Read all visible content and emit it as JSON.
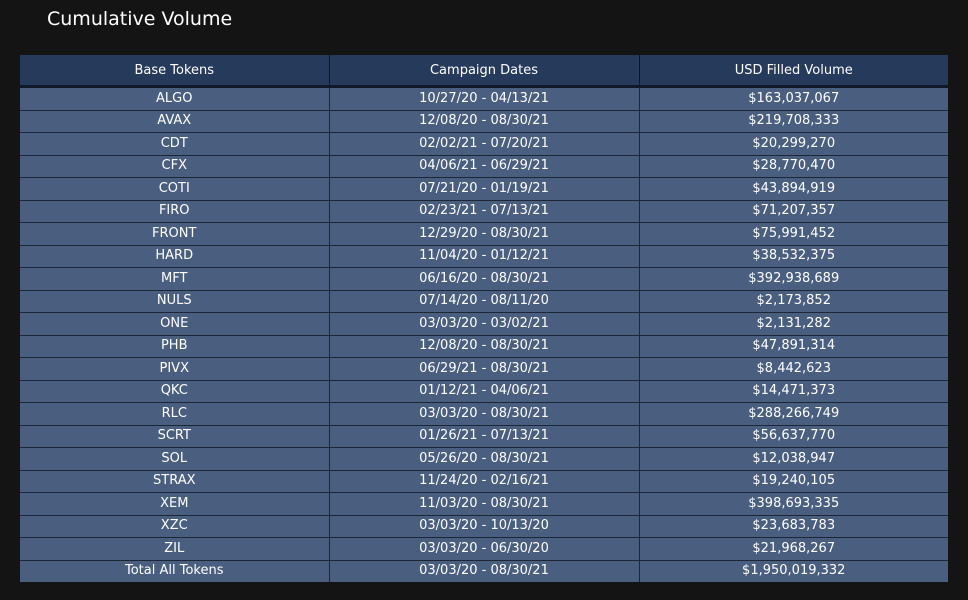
{
  "title": "Cumulative Volume",
  "table": {
    "headers": [
      "Base Tokens",
      "Campaign Dates",
      "USD Filled Volume"
    ],
    "rows": [
      [
        "ALGO",
        "10/27/20 - 04/13/21",
        "$163,037,067"
      ],
      [
        "AVAX",
        "12/08/20 - 08/30/21",
        "$219,708,333"
      ],
      [
        "CDT",
        "02/02/21 - 07/20/21",
        "$20,299,270"
      ],
      [
        "CFX",
        "04/06/21 - 06/29/21",
        "$28,770,470"
      ],
      [
        "COTI",
        "07/21/20 - 01/19/21",
        "$43,894,919"
      ],
      [
        "FIRO",
        "02/23/21 - 07/13/21",
        "$71,207,357"
      ],
      [
        "FRONT",
        "12/29/20 - 08/30/21",
        "$75,991,452"
      ],
      [
        "HARD",
        "11/04/20 - 01/12/21",
        "$38,532,375"
      ],
      [
        "MFT",
        "06/16/20 - 08/30/21",
        "$392,938,689"
      ],
      [
        "NULS",
        "07/14/20 - 08/11/20",
        "$2,173,852"
      ],
      [
        "ONE",
        "03/03/20 - 03/02/21",
        "$2,131,282"
      ],
      [
        "PHB",
        "12/08/20 - 08/30/21",
        "$47,891,314"
      ],
      [
        "PIVX",
        "06/29/21 - 08/30/21",
        "$8,442,623"
      ],
      [
        "QKC",
        "01/12/21 - 04/06/21",
        "$14,471,373"
      ],
      [
        "RLC",
        "03/03/20 - 08/30/21",
        "$288,266,749"
      ],
      [
        "SCRT",
        "01/26/21 - 07/13/21",
        "$56,637,770"
      ],
      [
        "SOL",
        "05/26/20 - 08/30/21",
        "$12,038,947"
      ],
      [
        "STRAX",
        "11/24/20 - 02/16/21",
        "$19,240,105"
      ],
      [
        "XEM",
        "11/03/20 - 08/30/21",
        "$398,693,335"
      ],
      [
        "XZC",
        "03/03/20 - 10/13/20",
        "$23,683,783"
      ],
      [
        "ZIL",
        "03/03/20 - 06/30/20",
        "$21,968,267"
      ],
      [
        "Total All Tokens",
        "03/03/20 - 08/30/21",
        "$1,950,019,332"
      ]
    ]
  }
}
